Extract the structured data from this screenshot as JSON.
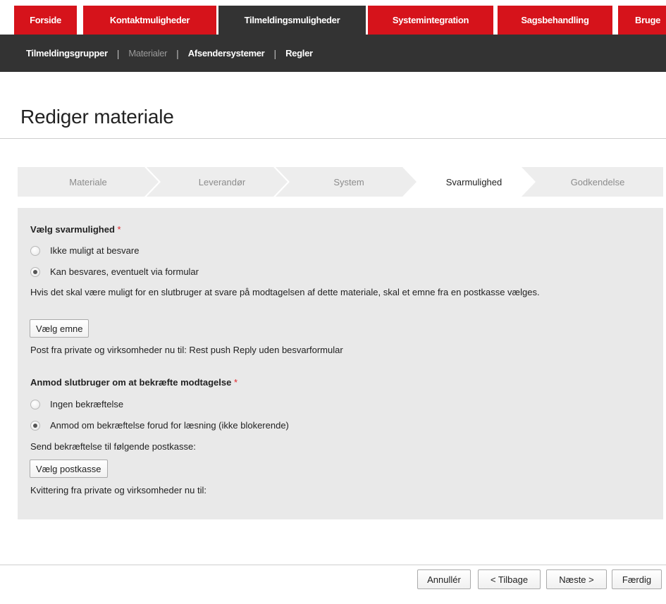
{
  "top_tabs": [
    {
      "label": "Forside"
    },
    {
      "label": "Kontaktmuligheder"
    },
    {
      "label": "Tilmeldingsmuligheder"
    },
    {
      "label": "Systemintegration"
    },
    {
      "label": "Sagsbehandling"
    },
    {
      "label": "Bruge"
    }
  ],
  "top_tabs_active_index": 2,
  "sub_nav": [
    {
      "label": "Tilmeldingsgrupper"
    },
    {
      "label": "Materialer"
    },
    {
      "label": "Afsendersystemer"
    },
    {
      "label": "Regler"
    }
  ],
  "sub_nav_separator": "|",
  "page_title": "Rediger materiale",
  "wizard": {
    "steps": [
      {
        "label": "Materiale"
      },
      {
        "label": "Leverandør"
      },
      {
        "label": "System"
      },
      {
        "label": "Svarmulighed"
      },
      {
        "label": "Godkendelse"
      }
    ],
    "active_index": 3
  },
  "form": {
    "reply_section": {
      "title": "Vælg svarmulighed",
      "required_mark": "*",
      "options": [
        {
          "label": "Ikke muligt at besvare",
          "checked": false
        },
        {
          "label": "Kan besvares, eventuelt via formular",
          "checked": true
        }
      ],
      "help_text": "Hvis det skal være muligt for en slutbruger at svare på modtagelsen af dette materiale, skal et emne fra en postkasse vælges.",
      "button_label": "Vælg emne",
      "status_text": "Post fra private og virksomheder nu til: Rest push Reply uden besvarformular"
    },
    "confirm_section": {
      "title": "Anmod slutbruger om at bekræfte modtagelse",
      "required_mark": "*",
      "options": [
        {
          "label": "Ingen bekræftelse",
          "checked": false
        },
        {
          "label": "Anmod om bekræftelse forud for læsning (ikke blokerende)",
          "checked": true
        }
      ],
      "send_text": "Send bekræftelse til følgende postkasse:",
      "button_label": "Vælg postkasse",
      "receipt_text": "Kvittering fra private og virksomheder nu til:"
    }
  },
  "footer": {
    "cancel_label": "Annullér",
    "back_label": "< Tilbage",
    "next_label": "Næste >",
    "finish_label": "Færdig"
  },
  "colors": {
    "brand_red": "#d6131b",
    "dark_bar": "#333333",
    "panel_bg": "#e9e9e9",
    "step_bg": "#ededed",
    "required": "#e0262c"
  }
}
